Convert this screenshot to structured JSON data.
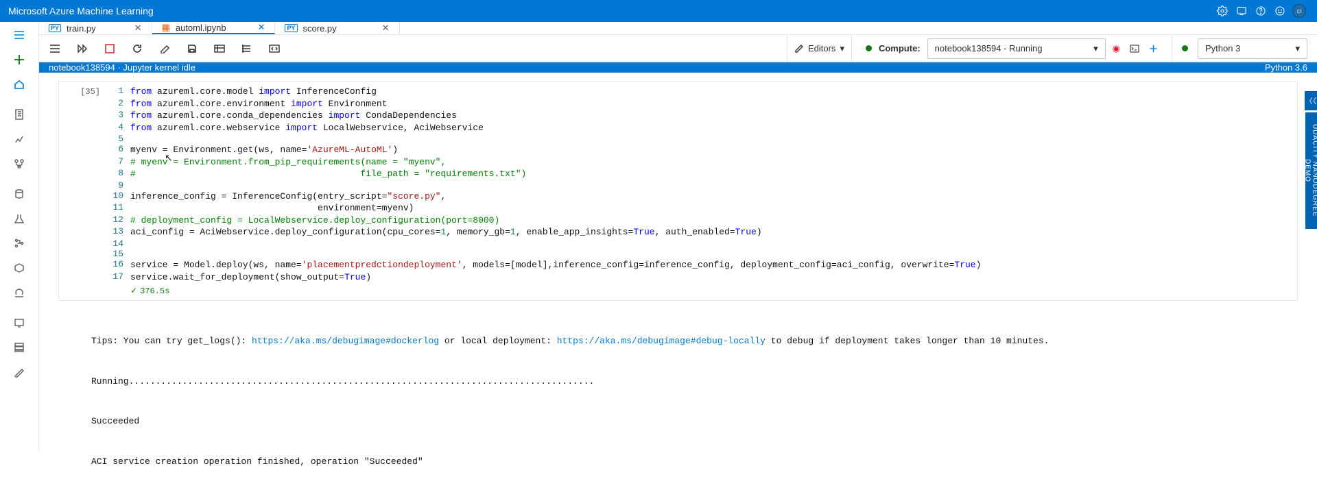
{
  "header": {
    "title": "Microsoft Azure Machine Learning",
    "avatar_initials": "ci"
  },
  "tabs": [
    {
      "kind": "py",
      "prefix": "PY",
      "label": "train.py"
    },
    {
      "kind": "nb",
      "prefix": "",
      "label": "automl.ipynb"
    },
    {
      "kind": "py",
      "prefix": "PY",
      "label": "score.py"
    }
  ],
  "toolbar": {
    "editors_label": "Editors",
    "compute_label": "Compute:",
    "compute_value": "notebook138594   -   Running",
    "kernel_value": "Python 3"
  },
  "status_bar": {
    "left": "notebook138594 · Jupyter kernel idle",
    "right": "Python 3.6"
  },
  "side_panel_label": "UDACITY NANODEGREE DEMO",
  "cell": {
    "prompt": "[35]",
    "lines": [
      {
        "n": 1,
        "segs": [
          [
            "kw",
            "from"
          ],
          [
            "",
            " azureml.core.model "
          ],
          [
            "kw",
            "import"
          ],
          [
            "",
            " InferenceConfig"
          ]
        ]
      },
      {
        "n": 2,
        "segs": [
          [
            "kw",
            "from"
          ],
          [
            "",
            " azureml.core.environment "
          ],
          [
            "kw",
            "import"
          ],
          [
            "",
            " Environment"
          ]
        ]
      },
      {
        "n": 3,
        "segs": [
          [
            "kw",
            "from"
          ],
          [
            "",
            " azureml.core.conda_dependencies "
          ],
          [
            "kw",
            "import"
          ],
          [
            "",
            " CondaDependencies"
          ]
        ]
      },
      {
        "n": 4,
        "segs": [
          [
            "kw",
            "from"
          ],
          [
            "",
            " azureml.core.webservice "
          ],
          [
            "kw",
            "import"
          ],
          [
            "",
            " LocalWebservice, AciWebservice"
          ]
        ]
      },
      {
        "n": 5,
        "segs": [
          [
            "",
            ""
          ]
        ]
      },
      {
        "n": 6,
        "segs": [
          [
            "",
            "myenv = Environment.get(ws, name="
          ],
          [
            "str",
            "'AzureML-AutoML'"
          ],
          [
            "",
            ")"
          ]
        ]
      },
      {
        "n": 7,
        "segs": [
          [
            "cmt",
            "# myenv = Environment.from_pip_requirements(name = \"myenv\","
          ]
        ]
      },
      {
        "n": 8,
        "segs": [
          [
            "cmt",
            "#                                          file_path = \"requirements.txt\")"
          ]
        ]
      },
      {
        "n": 9,
        "segs": [
          [
            "",
            ""
          ]
        ]
      },
      {
        "n": 10,
        "segs": [
          [
            "",
            "inference_config = InferenceConfig(entry_script="
          ],
          [
            "str",
            "\"score.py\""
          ],
          [
            "",
            ","
          ]
        ]
      },
      {
        "n": 11,
        "segs": [
          [
            "",
            "                                   environment=myenv)"
          ]
        ]
      },
      {
        "n": 12,
        "segs": [
          [
            "cmt",
            "# deployment_config = LocalWebservice.deploy_configuration(port=8000)"
          ]
        ]
      },
      {
        "n": 13,
        "segs": [
          [
            "",
            "aci_config = AciWebservice.deploy_configuration(cpu_cores="
          ],
          [
            "num",
            "1"
          ],
          [
            "",
            ", memory_gb="
          ],
          [
            "num",
            "1"
          ],
          [
            "",
            ", enable_app_insights="
          ],
          [
            "kw",
            "True"
          ],
          [
            "",
            ", auth_enabled="
          ],
          [
            "kw",
            "True"
          ],
          [
            "",
            ")"
          ]
        ]
      },
      {
        "n": 14,
        "segs": [
          [
            "",
            ""
          ]
        ]
      },
      {
        "n": 15,
        "segs": [
          [
            "",
            ""
          ]
        ]
      },
      {
        "n": 16,
        "segs": [
          [
            "",
            "service = Model.deploy(ws, name="
          ],
          [
            "str",
            "'placementpredctiondeployment'"
          ],
          [
            "",
            ", models=[model],inference_config=inference_config, deployment_config=aci_config, overwrite="
          ],
          [
            "kw",
            "True"
          ],
          [
            "",
            ")"
          ]
        ]
      },
      {
        "n": 17,
        "segs": [
          [
            "",
            "service.wait_for_deployment(show_output="
          ],
          [
            "kw",
            "True"
          ],
          [
            "",
            ")"
          ]
        ]
      }
    ],
    "timing": "376.5s"
  },
  "output": {
    "tips_prefix": "Tips: You can try get_logs(): ",
    "url1": "https://aka.ms/debugimage#dockerlog",
    "tips_mid": " or local deployment: ",
    "url2": "https://aka.ms/debugimage#debug-locally",
    "tips_suffix": " to debug if deployment takes longer than 10 minutes.",
    "running_dots": "Running.......................................................................................",
    "succeeded": "Succeeded",
    "aci_finished": "ACI service creation operation finished, operation \"Succeeded\""
  }
}
